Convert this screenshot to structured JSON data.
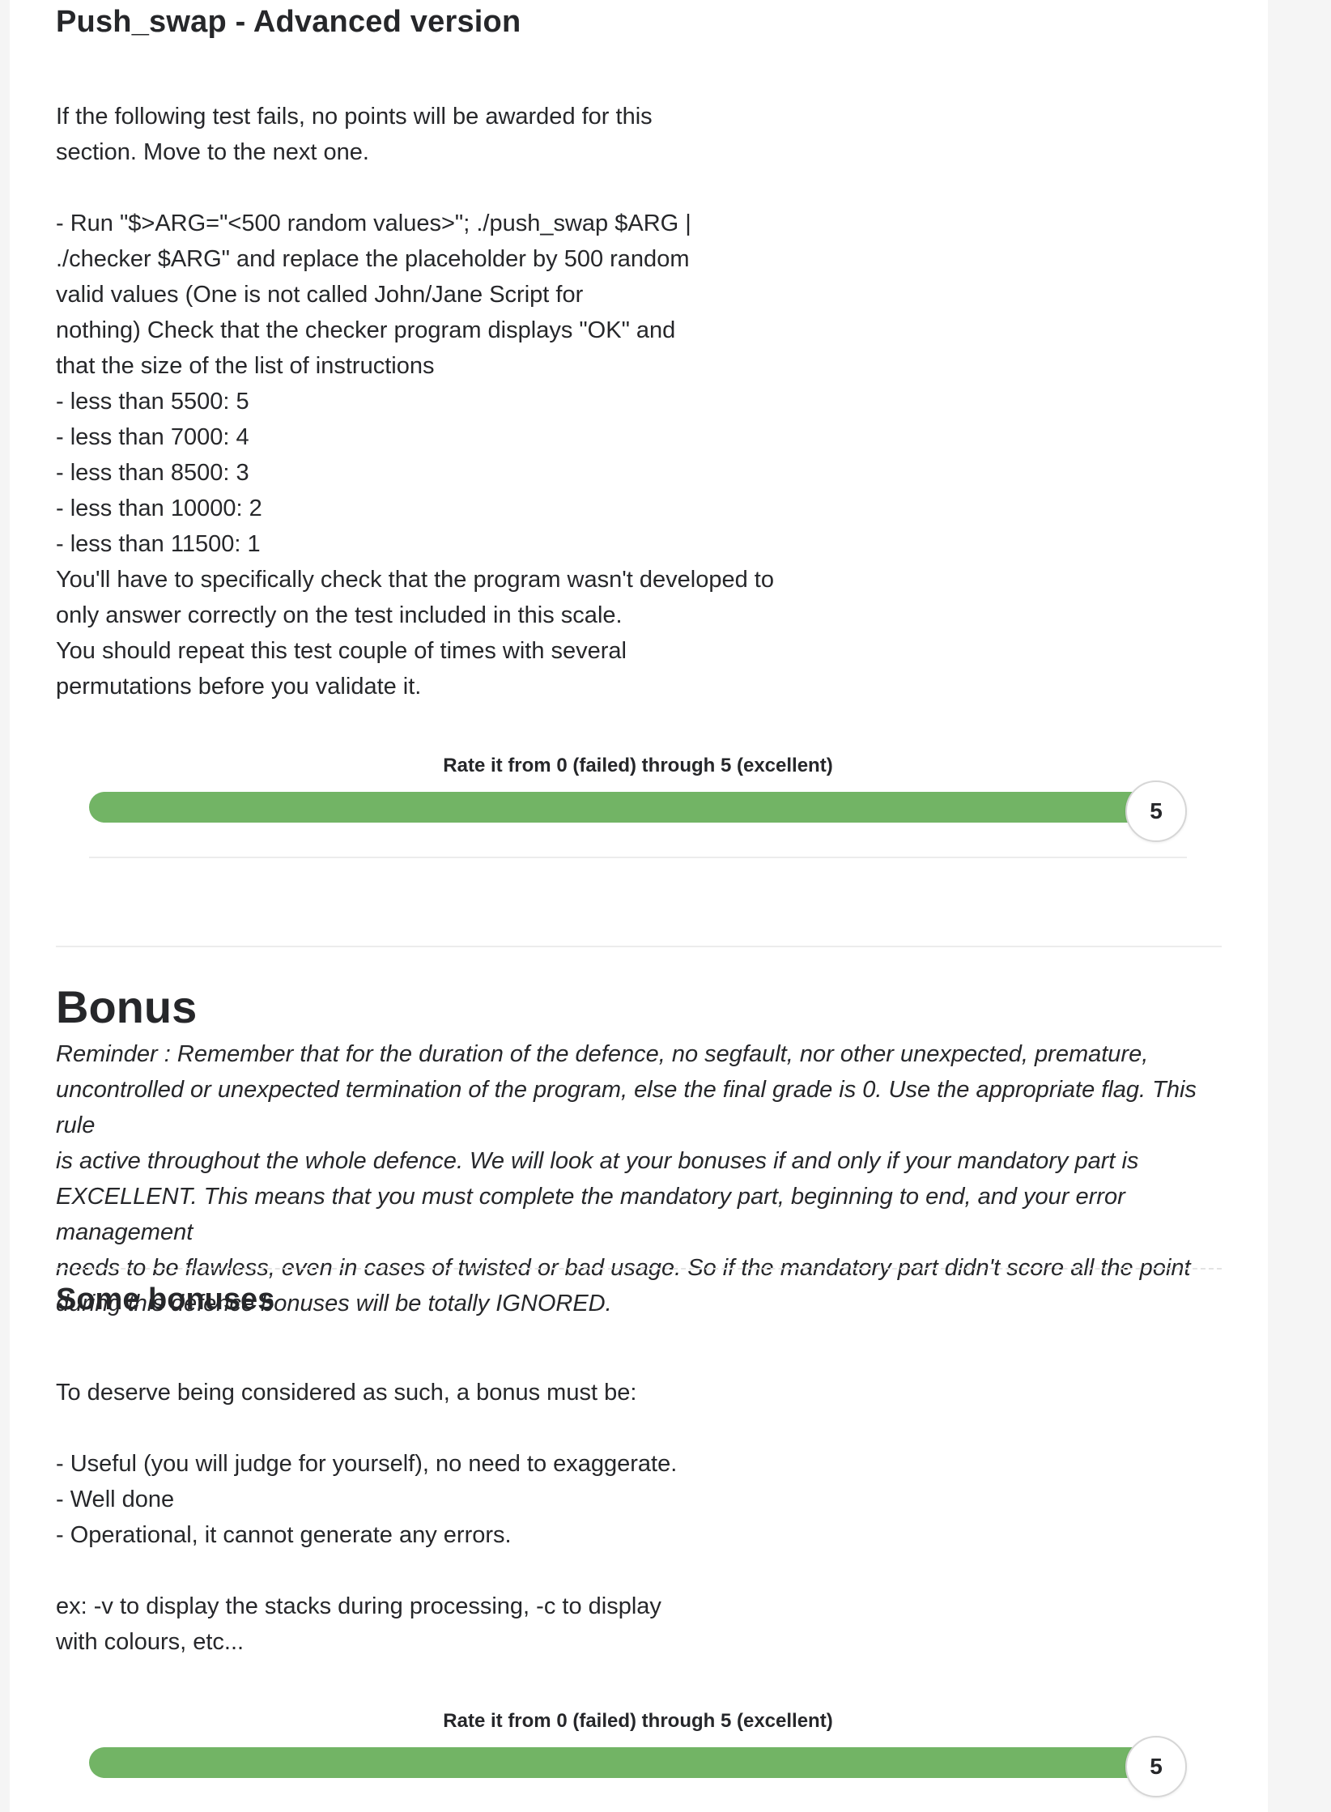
{
  "advanced": {
    "title": "Push_swap - Advanced version",
    "lines": [
      "If the following test fails, no points will be awarded for this",
      "section. Move to the next one.",
      "",
      "- Run \"$>ARG=\"<500 random values>\"; ./push_swap $ARG |",
      "./checker $ARG\" and replace the placeholder by 500 random",
      "valid values (One is not called John/Jane Script for",
      "nothing) Check that the checker program displays \"OK\" and",
      "that the size of the list of instructions",
      "- less than 5500: 5",
      "- less than 7000: 4",
      "- less than 8500: 3",
      "- less than 10000: 2",
      "- less than 11500: 1",
      "You'll have to specifically check that the program wasn't developed to",
      "only answer correctly on the test included in this scale.",
      "You should repeat this test couple of times with several",
      "permutations before you validate it."
    ],
    "rating": {
      "label": "Rate it from 0 (failed) through 5 (excellent)",
      "value": "5",
      "fraction": 1.0
    }
  },
  "bonus": {
    "title": "Bonus",
    "reminder_lines": [
      "Reminder : Remember that for the duration of the defence, no segfault, nor other unexpected, premature,",
      "uncontrolled or unexpected termination of the program, else the final grade is 0. Use the appropriate flag. This rule",
      "is active throughout the whole defence. We will look at your bonuses if and only if your mandatory part is",
      "EXCELLENT. This means that you must complete the mandatory part, beginning to end, and your error management",
      "needs to be flawless, even in cases of twisted or bad usage. So if the mandatory part didn't score all the point",
      "during this defence bonuses will be totally IGNORED."
    ],
    "some_bonuses": {
      "title": "Some bonuses",
      "lines": [
        "To deserve being considered as such, a bonus must be:",
        "",
        "- Useful (you will judge for yourself), no need to exaggerate.",
        "- Well done",
        "- Operational, it cannot generate any errors.",
        "",
        "ex: -v to display the stacks during processing, -c to display",
        "with colours, etc..."
      ],
      "rating": {
        "label": "Rate it from 0 (failed) through 5 (excellent)",
        "value": "5",
        "fraction": 1.0
      }
    }
  }
}
